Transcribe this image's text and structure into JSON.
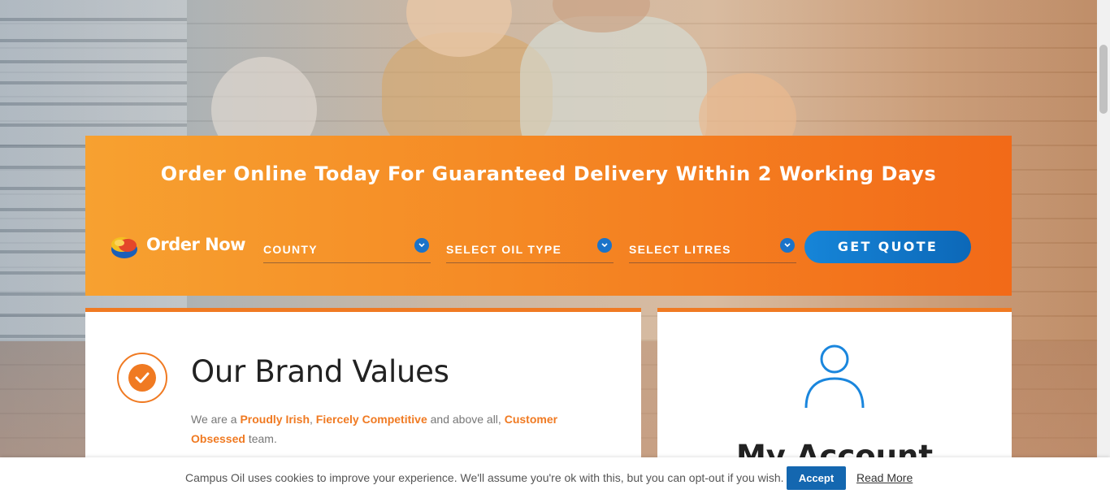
{
  "order_panel": {
    "title": "Order Online Today For Guaranteed Delivery Within 2 Working Days",
    "order_now_label": "Order Now",
    "county_label": "COUNTY",
    "oil_type_label": "SELECT OIL TYPE",
    "litres_label": "SELECT LITRES",
    "get_quote_label": "GET QUOTE"
  },
  "brand_card": {
    "title": "Our Brand Values",
    "text_prefix": "We are a ",
    "highlight1": "Proudly Irish",
    "sep1": ", ",
    "highlight2": "Fiercely Competitive",
    "sep2": " and above all, ",
    "highlight3": "Customer Obsessed",
    "text_suffix": " team."
  },
  "account_card": {
    "title": "My Account"
  },
  "cookie_bar": {
    "text": "Campus Oil uses cookies to improve your experience. We'll assume you're ok with this, but you can opt-out if you wish.",
    "accept_label": "Accept",
    "read_more_label": "Read More"
  },
  "colors": {
    "accent_orange": "#f07a22",
    "button_blue": "#1467b0"
  }
}
